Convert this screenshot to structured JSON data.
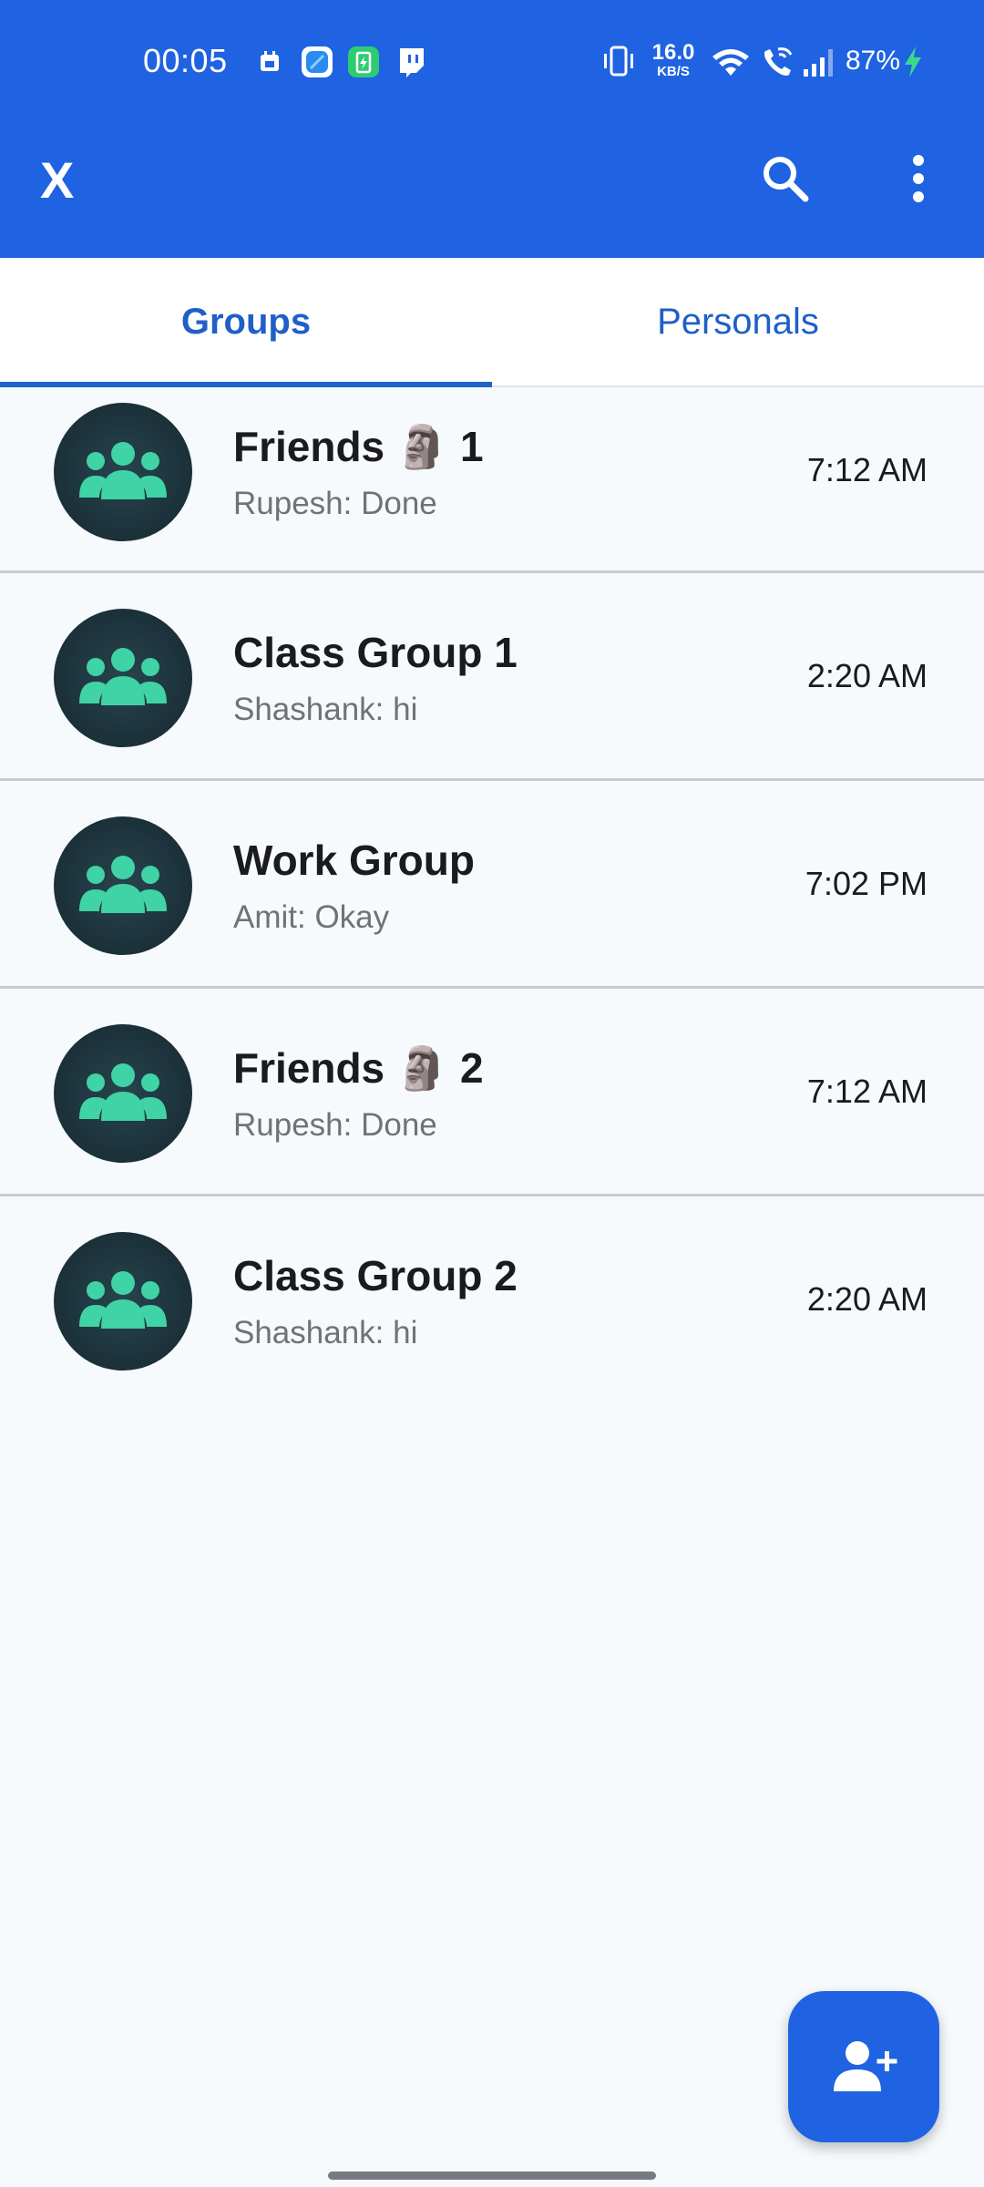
{
  "status_bar": {
    "time": "00:05",
    "net_speed_value": "16.0",
    "net_speed_unit": "KB/S",
    "battery": "87%"
  },
  "app_bar": {
    "close_label": "X"
  },
  "tabs": [
    {
      "label": "Groups",
      "selected": true
    },
    {
      "label": "Personals",
      "selected": false
    }
  ],
  "chats": [
    {
      "name": "Friends 🗿 1",
      "preview": "Rupesh: Done",
      "time": "7:12 AM"
    },
    {
      "name": "Class Group 1",
      "preview": "Shashank: hi",
      "time": "2:20 AM"
    },
    {
      "name": "Work Group",
      "preview": "Amit: Okay",
      "time": "7:02 PM"
    },
    {
      "name": "Friends 🗿 2",
      "preview": "Rupesh: Done",
      "time": "7:12 AM"
    },
    {
      "name": "Class Group 2",
      "preview": "Shashank: hi",
      "time": "2:20 AM"
    }
  ],
  "colors": {
    "primary": "#1f63e2",
    "tab_text": "#1f5fc8",
    "avatar_bg": "#1b3039",
    "avatar_icon": "#3fd3a6",
    "charging": "#3ad98a"
  },
  "icons": {
    "close": "close-icon",
    "search": "search-icon",
    "more": "more-vert-icon",
    "avatar": "group-icon",
    "fab": "add-person-icon"
  }
}
